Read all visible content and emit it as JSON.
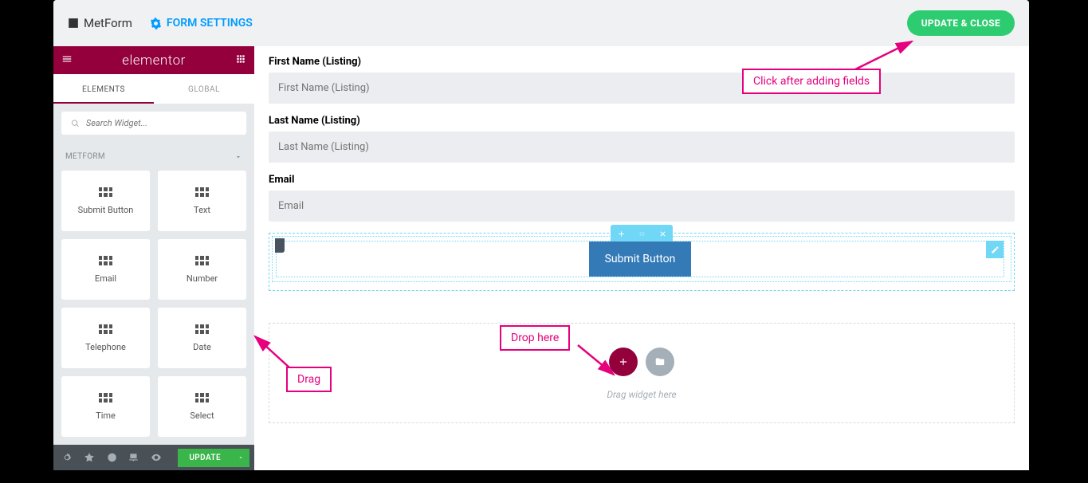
{
  "topbar": {
    "app_name": "MetForm",
    "form_settings_label": "FORM SETTINGS",
    "update_close_label": "UPDATE & CLOSE"
  },
  "sidebar": {
    "brand": "elementor",
    "tabs": {
      "elements": "ELEMENTS",
      "global": "GLOBAL"
    },
    "search_placeholder": "Search Widget...",
    "category": "METFORM",
    "widgets": [
      {
        "label": "Submit Button"
      },
      {
        "label": "Text"
      },
      {
        "label": "Email"
      },
      {
        "label": "Number"
      },
      {
        "label": "Telephone"
      },
      {
        "label": "Date"
      },
      {
        "label": "Time"
      },
      {
        "label": "Select"
      }
    ],
    "footer": {
      "update_label": "UPDATE"
    }
  },
  "canvas": {
    "fields": [
      {
        "label": "First Name (Listing)",
        "placeholder": "First Name (Listing)"
      },
      {
        "label": "Last Name (Listing)",
        "placeholder": "Last Name (Listing)"
      },
      {
        "label": "Email",
        "placeholder": "Email"
      }
    ],
    "submit_button_label": "Submit Button",
    "drop_hint": "Drag widget here"
  },
  "annotations": {
    "drag": "Drag",
    "drop_here": "Drop here",
    "click_after": "Click after adding fields"
  }
}
